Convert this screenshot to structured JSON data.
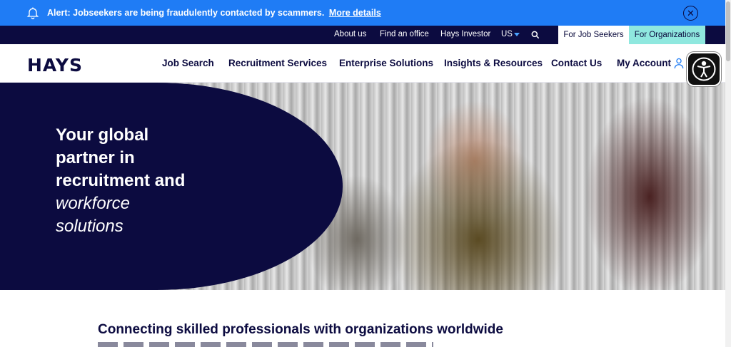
{
  "alert": {
    "text": "Alert: Jobseekers are being fraudulently contacted by scammers.",
    "link_label": "More details",
    "close_icon": "close-circle-icon",
    "bell_icon": "bell-icon"
  },
  "utility_nav": {
    "links": [
      "About us",
      "Find an office",
      "Hays Investor",
      "US"
    ],
    "search_icon": "search-icon",
    "segments": [
      "For Job Seekers",
      "For Organizations"
    ]
  },
  "main_nav": {
    "logo": "HAYS",
    "items": [
      "Job Search",
      "Recruitment Services",
      "Enterprise Solutions",
      "Insights & Resources",
      "Contact Us",
      "My Account"
    ],
    "user_icon": "user-icon"
  },
  "accessibility_icon": "accessibility-icon",
  "hero": {
    "headline_line1": "Your global",
    "headline_line2": "partner in",
    "headline_line3": "recruitment and",
    "headline_italic1": "workforce",
    "headline_italic2": "solutions"
  },
  "section": {
    "title": "Connecting skilled professionals with organizations worldwide"
  },
  "colors": {
    "alert_bg": "#1f7cf5",
    "brand_navy": "#0c0b40",
    "orgs_accent": "#8fe8df"
  }
}
